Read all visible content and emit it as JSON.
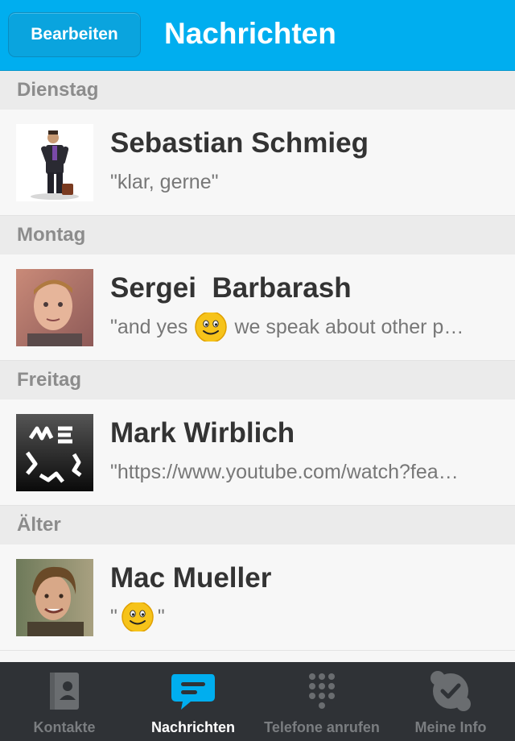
{
  "header": {
    "edit_label": "Bearbeiten",
    "title": "Nachrichten"
  },
  "sections": [
    {
      "label": "Dienstag",
      "contact": {
        "name": "Sebastian Schmieg",
        "snippet_before": "\"klar, gerne\"",
        "emoji": false,
        "snippet_after": ""
      }
    },
    {
      "label": "Montag",
      "contact": {
        "name": "Sergei  Barbarash",
        "snippet_before": "\"and yes",
        "emoji": true,
        "snippet_after": "we speak about other p…"
      }
    },
    {
      "label": "Freitag",
      "contact": {
        "name": "Mark Wirblich",
        "snippet_before": "\"https://www.youtube.com/watch?fea…",
        "emoji": false,
        "snippet_after": ""
      }
    },
    {
      "label": "Älter",
      "contact": {
        "name": "Mac Mueller",
        "snippet_before": "\"",
        "emoji": true,
        "snippet_after": "\""
      }
    }
  ],
  "tabs": [
    {
      "label": "Kontakte",
      "icon": "contacts-icon",
      "active": false
    },
    {
      "label": "Nachrichten",
      "icon": "chat-bubble-icon",
      "active": true
    },
    {
      "label": "Telefone anrufen",
      "icon": "dialpad-icon",
      "active": false
    },
    {
      "label": "Meine Info",
      "icon": "skype-check-icon",
      "active": false
    }
  ],
  "colors": {
    "accent": "#00aeef",
    "tabbar": "#2f3236"
  }
}
